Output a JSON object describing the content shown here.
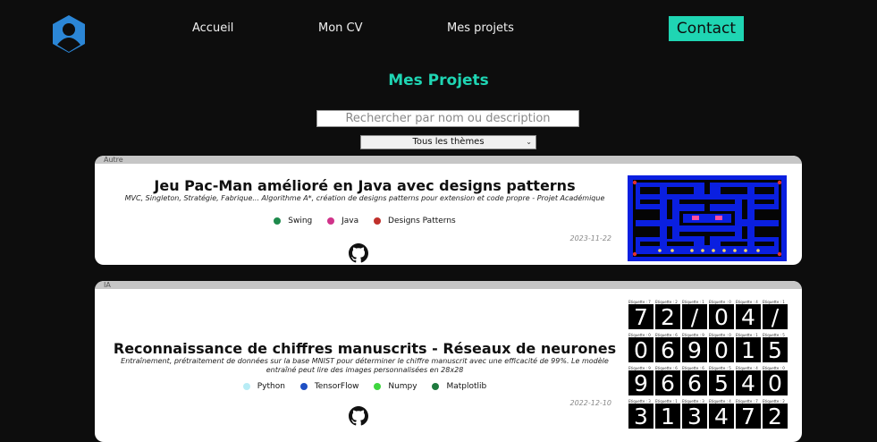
{
  "nav": {
    "logo_icon": "user-profile-icon",
    "links": [
      "Accueil",
      "Mon CV",
      "Mes projets"
    ],
    "contact": "Contact",
    "accent_color": "#1fd5b3"
  },
  "page_title": "Mes Projets",
  "search": {
    "placeholder": "Rechercher par nom ou description",
    "value": ""
  },
  "theme_select": {
    "selected": "Tous les thèmes"
  },
  "projects": [
    {
      "category": "Autre",
      "title": "Jeu Pac-Man amélioré en Java avec designs patterns",
      "description": "MVC, Singleton, Stratégie, Fabrique... Algorithme A*, création de designs patterns pour extension et code propre - Projet Académique",
      "tags": [
        {
          "label": "Swing",
          "color": "#1e8a4c"
        },
        {
          "label": "Java",
          "color": "#d0338a"
        },
        {
          "label": "Designs Patterns",
          "color": "#c0302b"
        }
      ],
      "date": "2023-11-22",
      "link_icon": "github-icon",
      "thumbnail": "pacman-game-screenshot"
    },
    {
      "category": "IA",
      "title": "Reconnaissance de chiffres manuscrits - Réseaux de neurones",
      "description": "Entraînement, prétraitement de données sur la base MNIST pour déterminer le chiffre manuscrit avec une efficacité de 99%. Le modèle entraîné peut lire des images personnalisées en 28x28",
      "tags": [
        {
          "label": "Python",
          "color": "#b8ecf5"
        },
        {
          "label": "TensorFlow",
          "color": "#1e4fc4"
        },
        {
          "label": "Numpy",
          "color": "#3fd63f"
        },
        {
          "label": "Matplotlib",
          "color": "#1e7a3e"
        }
      ],
      "date": "2022-12-10",
      "link_icon": "github-icon",
      "thumbnail": "mnist-samples-grid",
      "mnist": [
        [
          {
            "label": "Etiquette : 7",
            "digit": "7"
          },
          {
            "label": "Etiquette : 2",
            "digit": "2"
          },
          {
            "label": "Etiquette : 1",
            "digit": "/"
          },
          {
            "label": "Etiquette : 0",
            "digit": "0"
          },
          {
            "label": "Etiquette : 4",
            "digit": "4"
          },
          {
            "label": "Etiquette : 1",
            "digit": "/"
          }
        ],
        [
          {
            "label": "Etiquette : 0",
            "digit": "0"
          },
          {
            "label": "Etiquette : 6",
            "digit": "6"
          },
          {
            "label": "Etiquette : 9",
            "digit": "9"
          },
          {
            "label": "Etiquette : 0",
            "digit": "0"
          },
          {
            "label": "Etiquette : 1",
            "digit": "1"
          },
          {
            "label": "Etiquette : 5",
            "digit": "5"
          }
        ],
        [
          {
            "label": "Etiquette : 9",
            "digit": "9"
          },
          {
            "label": "Etiquette : 6",
            "digit": "6"
          },
          {
            "label": "Etiquette : 6",
            "digit": "6"
          },
          {
            "label": "Etiquette : 5",
            "digit": "5"
          },
          {
            "label": "Etiquette : 4",
            "digit": "4"
          },
          {
            "label": "Etiquette : 0",
            "digit": "0"
          }
        ],
        [
          {
            "label": "Etiquette : 3",
            "digit": "3"
          },
          {
            "label": "Etiquette : 1",
            "digit": "1"
          },
          {
            "label": "Etiquette : 3",
            "digit": "3"
          },
          {
            "label": "Etiquette : 4",
            "digit": "4"
          },
          {
            "label": "Etiquette : 7",
            "digit": "7"
          },
          {
            "label": "Etiquette : 2",
            "digit": "2"
          }
        ]
      ]
    }
  ]
}
